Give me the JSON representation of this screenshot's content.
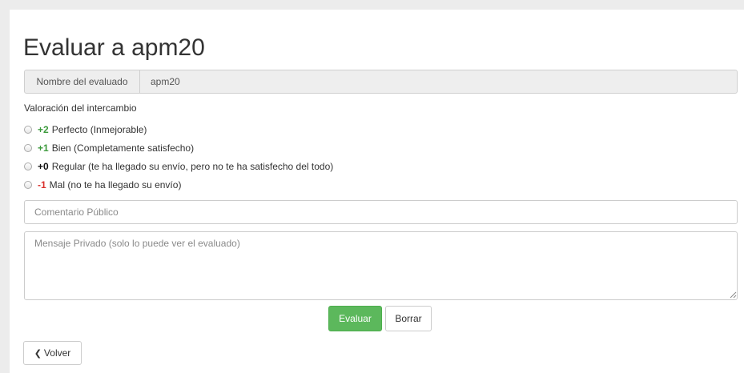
{
  "page": {
    "title": "Evaluar a apm20"
  },
  "evaluated": {
    "label": "Nombre del evaluado",
    "value": "apm20"
  },
  "rating": {
    "label": "Valoración del intercambio",
    "options": [
      {
        "score": "+2",
        "text": "Perfecto (Inmejorable)",
        "color": "#3c9a3c",
        "selected": false
      },
      {
        "score": "+1",
        "text": "Bien (Completamente satisfecho)",
        "color": "#3c9a3c",
        "selected": false
      },
      {
        "score": "+0",
        "text": "Regular (te ha llegado su envío, pero no te ha satisfecho del todo)",
        "color": "#111111",
        "selected": false
      },
      {
        "score": "-1",
        "text": "Mal (no te ha llegado su envío)",
        "color": "#d9302c",
        "selected": false
      }
    ]
  },
  "comment": {
    "placeholder": "Comentario Público",
    "value": ""
  },
  "message": {
    "placeholder": "Mensaje Privado (solo lo puede ver el evaluado)",
    "value": ""
  },
  "actions": {
    "submit_label": "Evaluar",
    "clear_label": "Borrar",
    "back_label": "Volver",
    "submit_color": "#5cb85c"
  },
  "icons": {
    "back": "chevron-left-icon",
    "grip": "resize-grip-icon"
  }
}
